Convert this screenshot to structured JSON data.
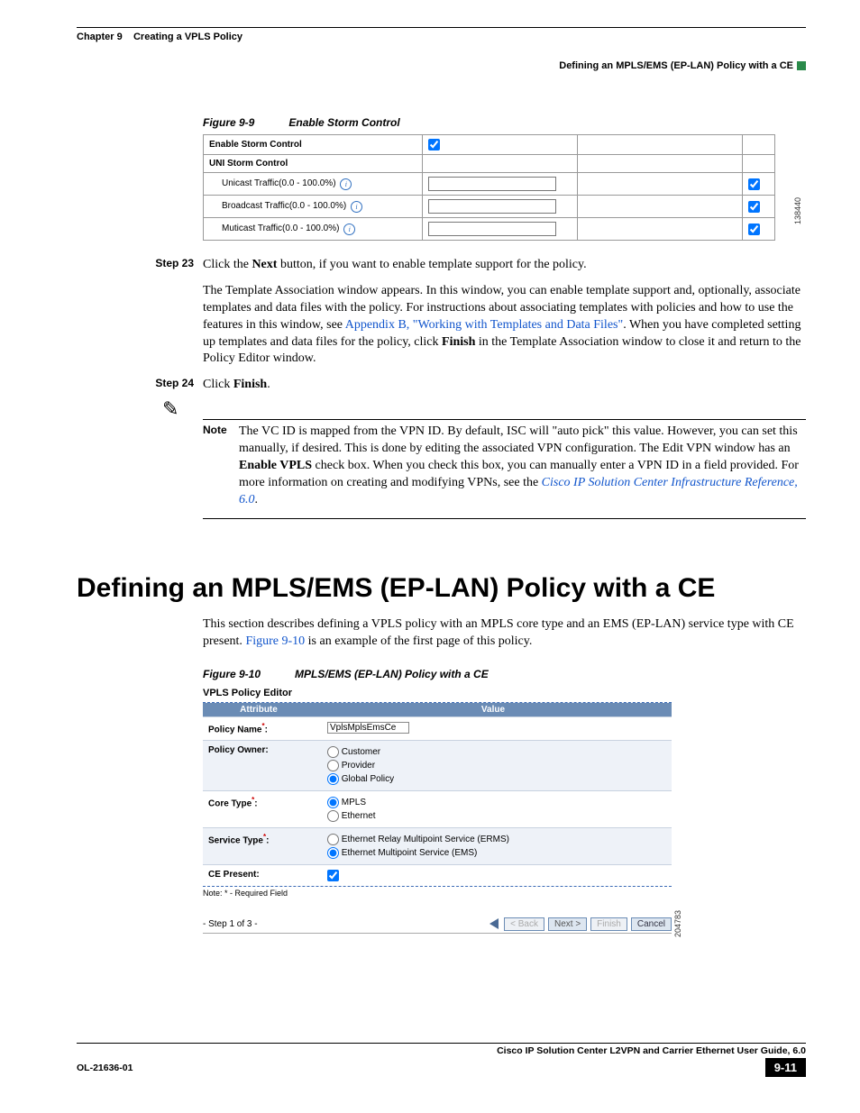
{
  "header": {
    "chapter": "Chapter 9",
    "chapter_title": "Creating a VPLS Policy",
    "breadcrumb": "Defining an MPLS/EMS (EP-LAN) Policy with a CE"
  },
  "figure9_9": {
    "caption_num": "Figure 9-9",
    "caption_title": "Enable Storm Control",
    "row_enable": "Enable Storm Control",
    "row_uni": "UNI Storm Control",
    "row_unicast": "Unicast Traffic(0.0 - 100.0%)",
    "row_broadcast": "Broadcast Traffic(0.0 - 100.0%)",
    "row_multicast": "Muticast Traffic(0.0 - 100.0%)",
    "side_num": "138440"
  },
  "step23": {
    "label": "Step 23",
    "p1a": "Click the ",
    "p1b": "Next",
    "p1c": " button, if you want to enable template support for the policy.",
    "p2a": "The Template Association window appears. In this window, you can enable template support and, optionally, associate templates and data files with the policy. For instructions about associating templates with policies and how to use the features in this window, see ",
    "p2link": "Appendix B, \"Working with Templates and Data Files\"",
    "p2b": ". When you have completed setting up templates and data files for the policy, click ",
    "p2bold": "Finish",
    "p2c": " in the Template Association window to close it and return to the Policy Editor window."
  },
  "step24": {
    "label": "Step 24",
    "p1a": "Click ",
    "p1b": "Finish",
    "p1c": "."
  },
  "note": {
    "label": "Note",
    "t1": "The VC ID is mapped from the VPN ID. By default, ISC will \"auto pick\" this value. However, you can set this manually, if desired. This is done by editing the associated VPN configuration. The Edit VPN window has an ",
    "t1bold": "Enable VPLS",
    "t2": " check box. When you check this box, you can manually enter a VPN ID in a field provided. For more information on creating and modifying VPNs, see the ",
    "t2link": "Cisco IP Solution Center Infrastructure Reference, 6.0",
    "t3": "."
  },
  "section": {
    "title": "Defining an MPLS/EMS (EP-LAN) Policy with a CE",
    "intro_a": "This section describes defining a VPLS policy with an MPLS core type and an EMS (EP-LAN) service type with CE present. ",
    "intro_link": "Figure 9-10",
    "intro_b": " is an example of the first page of this policy."
  },
  "figure9_10": {
    "caption_num": "Figure 9-10",
    "caption_title": "MPLS/EMS (EP-LAN) Policy with a CE",
    "editor_title": "VPLS Policy Editor",
    "col_attr": "Attribute",
    "col_val": "Value",
    "policy_name_label": "Policy Name",
    "policy_name_value": "VplsMplsEmsCe",
    "policy_owner_label": "Policy Owner:",
    "owner_opts": [
      "Customer",
      "Provider",
      "Global Policy"
    ],
    "core_type_label": "Core Type",
    "core_opts": [
      "MPLS",
      "Ethernet"
    ],
    "service_type_label": "Service Type",
    "service_opts": [
      "Ethernet Relay Multipoint Service (ERMS)",
      "Ethernet Multipoint Service (EMS)"
    ],
    "ce_present_label": "CE Present:",
    "note_foot": "Note: * - Required Field",
    "step_indicator": "- Step 1 of 3 -",
    "btn_back": "< Back",
    "btn_next": "Next >",
    "btn_finish": "Finish",
    "btn_cancel": "Cancel",
    "side_num": "204783"
  },
  "footer": {
    "guide": "Cisco IP Solution Center L2VPN and Carrier Ethernet User Guide, 6.0",
    "doc": "OL-21636-01",
    "page": "9-11"
  }
}
